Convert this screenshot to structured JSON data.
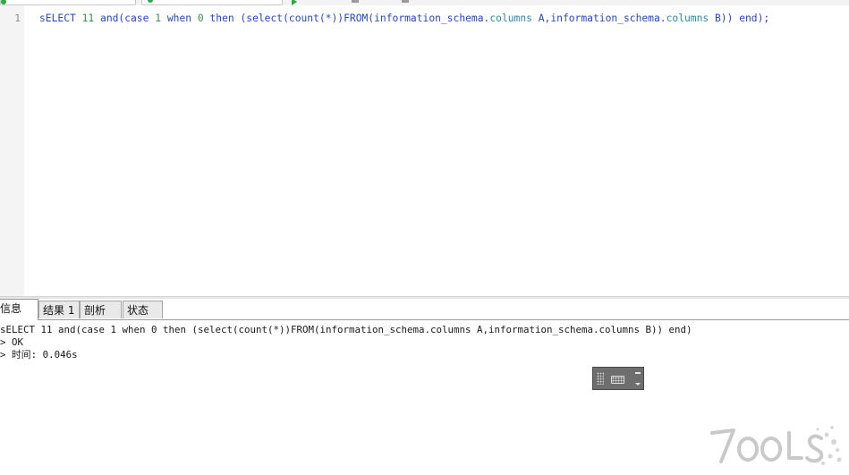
{
  "editor": {
    "line_number": "1",
    "code_tokens": [
      {
        "text": "sELECT ",
        "cls": "c-kw"
      },
      {
        "text": "11",
        "cls": "c-num"
      },
      {
        "text": " and(case ",
        "cls": "c-kw"
      },
      {
        "text": "1",
        "cls": "c-num"
      },
      {
        "text": " when ",
        "cls": "c-kw"
      },
      {
        "text": "0",
        "cls": "c-num"
      },
      {
        "text": " then (select(count(*))FROM(information_schema.",
        "cls": "c-kw"
      },
      {
        "text": "columns",
        "cls": "c-ident"
      },
      {
        "text": " A,information_schema.",
        "cls": "c-kw"
      },
      {
        "text": "columns",
        "cls": "c-ident"
      },
      {
        "text": " B)) end);",
        "cls": "c-kw"
      }
    ]
  },
  "result_tabs": [
    {
      "label": "信息",
      "active": true
    },
    {
      "label": "结果 1",
      "active": false
    },
    {
      "label": "剖析",
      "active": false
    },
    {
      "label": "状态",
      "active": false
    }
  ],
  "messages": {
    "query": "sELECT 11 and(case 1 when 0 then (select(count(*))FROM(information_schema.columns A,information_schema.columns B)) end)",
    "status": "> OK",
    "time": "> 时间: 0.046s"
  },
  "watermark": {
    "text": "7OOLS"
  },
  "colors": {
    "keyword": "#2546c8",
    "number": "#2a9a4a",
    "identifier": "#2a8aa6",
    "gutter_bg": "#f4f4f4"
  },
  "icons": [
    "ime-grip-icon",
    "keyboard-icon",
    "minimize-icon",
    "dropdown-arrow-icon"
  ]
}
